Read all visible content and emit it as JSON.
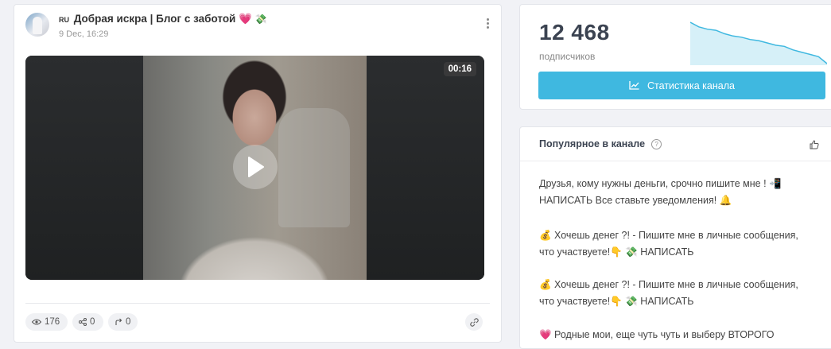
{
  "post": {
    "channel_flag": "RU",
    "channel_name": "Добрая искра | Блог с заботой",
    "heart_emoji": "💗",
    "money_emoji": "💸",
    "date": "9 Dec, 16:29",
    "video_duration": "00:16",
    "views": "176",
    "shares": "0",
    "forwards": "0"
  },
  "subscribers": {
    "count": "12 468",
    "label": "подписчиков",
    "stats_button_label": "Статистика канала",
    "sparkline": [
      100,
      96,
      94,
      93,
      90,
      88,
      87,
      85,
      84,
      82,
      80,
      79,
      76,
      74,
      72,
      70,
      64
    ],
    "accent_color": "#3fb8e0"
  },
  "popular": {
    "title": "Популярное в канале",
    "items": [
      {
        "line1": "Друзья, кому нужны деньги, срочно пишите мне ! 📲",
        "line2": "НАПИСАТЬ Все ставьте уведомления! 🔔"
      },
      {
        "line1": "💰 Хочешь денег ?! - Пишите мне в личные сообщения,",
        "line2": "что участвуете!👇 💸 НАПИСАТЬ"
      },
      {
        "line1": "💰 Хочешь денег ?! - Пишите мне в личные сообщения,",
        "line2": "что участвуете!👇 💸 НАПИСАТЬ"
      },
      {
        "line1": "💗 Родные мои, еще чуть чуть и выберу ВТОРОГО",
        "line2": ""
      }
    ]
  }
}
